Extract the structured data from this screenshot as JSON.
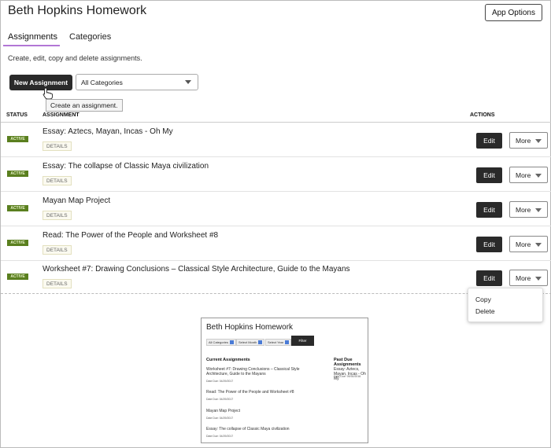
{
  "app": {
    "title": "Beth Hopkins Homework",
    "options_label": "App Options"
  },
  "tabs": [
    {
      "label": "Assignments",
      "active": true
    },
    {
      "label": "Categories",
      "active": false
    }
  ],
  "subtitle": "Create, edit, copy and delete assignments.",
  "toolbar": {
    "new_assignment_label": "New Assignment",
    "tooltip": "Create an assignment.",
    "category_value": "All Categories"
  },
  "table": {
    "headers": {
      "status": "STATUS",
      "assignment": "ASSIGNMENT",
      "actions": "ACTIONS"
    },
    "rows": [
      {
        "status": "ACTIVE",
        "title": "Essay: Aztecs, Mayan, Incas - Oh My",
        "details": "DETAILS",
        "edit": "Edit",
        "more": "More"
      },
      {
        "status": "ACTIVE",
        "title": "Essay: The collapse of Classic Maya civilization",
        "details": "DETAILS",
        "edit": "Edit",
        "more": "More"
      },
      {
        "status": "ACTIVE",
        "title": "Mayan Map Project",
        "details": "DETAILS",
        "edit": "Edit",
        "more": "More"
      },
      {
        "status": "ACTIVE",
        "title": "Read: The Power of the People and Worksheet #8",
        "details": "DETAILS",
        "edit": "Edit",
        "more": "More"
      },
      {
        "status": "ACTIVE",
        "title": "Worksheet #7: Drawing Conclusions – Classical Style Architecture, Guide to the Mayans",
        "details": "DETAILS",
        "edit": "Edit",
        "more": "More"
      }
    ]
  },
  "more_menu": {
    "items": [
      "Copy",
      "Delete"
    ]
  },
  "preview": {
    "title": "Beth Hopkins Homework",
    "filters": [
      "All Categories",
      "Select Month",
      "Select Year"
    ],
    "filter_button": "Filter",
    "current_heading": "Current Assignments",
    "past_heading": "Past Due Assignments",
    "current": [
      {
        "title_lines": [
          "Worksheet #7: Drawing Conclusions – Classical Style",
          "Architecture, Guide to the Mayans"
        ],
        "due": "Date Due: 04/29/2017"
      },
      {
        "title_lines": [
          "Read: The Power of the People and Worksheet #8"
        ],
        "due": "Date Due: 04/29/2017"
      },
      {
        "title_lines": [
          "Mayan Map Project"
        ],
        "due": "Date Due: 04/29/2017"
      },
      {
        "title_lines": [
          "Essay: The collapse of Classic Maya civilization"
        ],
        "due": "Date Due: 04/29/2017"
      }
    ],
    "past": [
      {
        "title_lines": [
          "Essay: Aztecs, Mayan, Incas - Oh My"
        ],
        "due": "Date Due: 09/30/2016"
      }
    ]
  },
  "colors": {
    "active_badge": "#5a7f1f",
    "tab_underline": "#b276d6",
    "dark_button": "#2a2a2a",
    "filter_swatch": "#4a7bd6"
  }
}
